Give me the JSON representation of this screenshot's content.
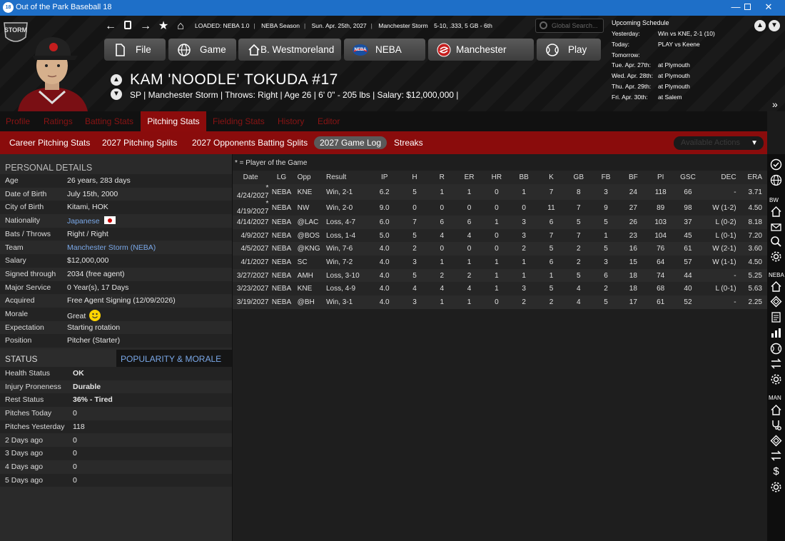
{
  "window": {
    "title": "Out of the Park Baseball 18",
    "app_icon": "18"
  },
  "header": {
    "team_logo_text": "STORM",
    "loaded": [
      "LOADED: NEBA 1.0",
      "NEBA Season",
      "Sun. Apr. 25th, 2027",
      "Manchester Storm",
      "5-10, .333, 5 GB - 6th"
    ],
    "search_placeholder": "Global Search...",
    "menu": [
      {
        "label": "File",
        "icon": "file-icon"
      },
      {
        "label": "Game",
        "icon": "globe-icon"
      },
      {
        "label": "B. Westmoreland",
        "icon": "home-icon"
      },
      {
        "label": "NEBA",
        "icon": "neba-logo-icon"
      },
      {
        "label": "Manchester",
        "icon": "storm-logo-icon"
      },
      {
        "label": "Play",
        "icon": "baseball-icon"
      }
    ],
    "player_name": "KAM 'NOODLE' TOKUDA  #17",
    "player_info": "SP | Manchester Storm  |  Throws: Right  |  Age 26  |  6' 0\" - 205 lbs  |  Salary: $12,000,000  |"
  },
  "schedule": {
    "title": "Upcoming Schedule",
    "rows": [
      {
        "k": "Yesterday:",
        "v": "Win vs KNE, 2-1 (10)"
      },
      {
        "k": "Today:",
        "v": "PLAY vs Keene"
      },
      {
        "k": "Tomorrow:",
        "v": ""
      },
      {
        "k": "Tue. Apr. 27th:",
        "v": "at Plymouth"
      },
      {
        "k": "Wed. Apr. 28th:",
        "v": "at Plymouth"
      },
      {
        "k": "Thu. Apr. 29th:",
        "v": "at Plymouth"
      },
      {
        "k": "Fri. Apr. 30th:",
        "v": "at Salem"
      }
    ]
  },
  "tabs": [
    "Profile",
    "Ratings",
    "Batting Stats",
    "Pitching Stats",
    "Fielding Stats",
    "History",
    "Editor"
  ],
  "active_tab": "Pitching Stats",
  "subtabs": [
    "Career Pitching Stats",
    "2027 Pitching Splits",
    "2027 Opponents Batting Splits",
    "2027 Game Log",
    "Streaks"
  ],
  "active_subtab": "2027 Game Log",
  "actions_label": "Available Actions",
  "personal": {
    "title": "PERSONAL DETAILS",
    "rows": [
      {
        "k": "Age",
        "v": "26 years, 283 days"
      },
      {
        "k": "Date of Birth",
        "v": "July 15th, 2000"
      },
      {
        "k": "City of Birth",
        "v": "Kitami, HOK"
      },
      {
        "k": "Nationality",
        "v": "Japanese"
      },
      {
        "k": "Bats / Throws",
        "v": "Right / Right"
      },
      {
        "k": "Team",
        "v": "Manchester Storm (NEBA)"
      },
      {
        "k": "Salary",
        "v": "$12,000,000"
      },
      {
        "k": "Signed through",
        "v": "2034 (free agent)"
      },
      {
        "k": "Major Service",
        "v": "0 Year(s), 17 Days"
      },
      {
        "k": "Acquired",
        "v": "Free Agent Signing (12/09/2026)"
      },
      {
        "k": "Morale",
        "v": "Great"
      },
      {
        "k": "Expectation",
        "v": "Starting rotation"
      },
      {
        "k": "Position",
        "v": "Pitcher (Starter)"
      }
    ]
  },
  "status": {
    "tab_status": "STATUS",
    "tab_popularity": "POPULARITY & MORALE",
    "rows": [
      {
        "k": "Health Status",
        "v": "OK"
      },
      {
        "k": "Injury Proneness",
        "v": "Durable"
      },
      {
        "k": "Rest Status",
        "v": "36% - Tired"
      },
      {
        "k": "Pitches Today",
        "v": "0"
      },
      {
        "k": "Pitches Yesterday",
        "v": "118"
      },
      {
        "k": "2 Days ago",
        "v": "0"
      },
      {
        "k": "3 Days ago",
        "v": "0"
      },
      {
        "k": "4 Days ago",
        "v": "0"
      },
      {
        "k": "5 Days ago",
        "v": "0"
      }
    ]
  },
  "gamelog": {
    "note": "* = Player of the Game",
    "columns": [
      "Date",
      "LG",
      "Opp",
      "Result",
      "IP",
      "H",
      "R",
      "ER",
      "HR",
      "BB",
      "K",
      "GB",
      "FB",
      "BF",
      "PI",
      "GSC",
      "DEC",
      "ERA"
    ],
    "rows": [
      [
        "* 4/24/2027",
        "NEBA",
        "KNE",
        "Win, 2-1",
        "6.2",
        "5",
        "1",
        "1",
        "0",
        "1",
        "7",
        "8",
        "3",
        "24",
        "118",
        "66",
        "-",
        "3.71"
      ],
      [
        "* 4/19/2027",
        "NEBA",
        "NW",
        "Win, 2-0",
        "9.0",
        "0",
        "0",
        "0",
        "0",
        "0",
        "11",
        "7",
        "9",
        "27",
        "89",
        "98",
        "W (1-2)",
        "4.50"
      ],
      [
        "4/14/2027",
        "NEBA",
        "@LAC",
        "Loss, 4-7",
        "6.0",
        "7",
        "6",
        "6",
        "1",
        "3",
        "6",
        "5",
        "5",
        "26",
        "103",
        "37",
        "L (0-2)",
        "8.18"
      ],
      [
        "4/9/2027",
        "NEBA",
        "@BOS",
        "Loss, 1-4",
        "5.0",
        "5",
        "4",
        "4",
        "0",
        "3",
        "7",
        "7",
        "1",
        "23",
        "104",
        "45",
        "L (0-1)",
        "7.20"
      ],
      [
        "4/5/2027",
        "NEBA",
        "@KNG",
        "Win, 7-6",
        "4.0",
        "2",
        "0",
        "0",
        "0",
        "2",
        "5",
        "2",
        "5",
        "16",
        "76",
        "61",
        "W (2-1)",
        "3.60"
      ],
      [
        "4/1/2027",
        "NEBA",
        "SC",
        "Win, 7-2",
        "4.0",
        "3",
        "1",
        "1",
        "1",
        "1",
        "6",
        "2",
        "3",
        "15",
        "64",
        "57",
        "W (1-1)",
        "4.50"
      ],
      [
        "3/27/2027",
        "NEBA",
        "AMH",
        "Loss, 3-10",
        "4.0",
        "5",
        "2",
        "2",
        "1",
        "1",
        "1",
        "5",
        "6",
        "18",
        "74",
        "44",
        "-",
        "5.25"
      ],
      [
        "3/23/2027",
        "NEBA",
        "KNE",
        "Loss, 4-9",
        "4.0",
        "4",
        "4",
        "4",
        "1",
        "3",
        "5",
        "4",
        "2",
        "18",
        "68",
        "40",
        "L (0-1)",
        "5.63"
      ],
      [
        "3/19/2027",
        "NEBA",
        "@BH",
        "Win, 3-1",
        "4.0",
        "3",
        "1",
        "1",
        "0",
        "2",
        "2",
        "4",
        "5",
        "17",
        "61",
        "52",
        "-",
        "2.25"
      ]
    ]
  },
  "sidebar_labels": {
    "bw": "BW",
    "neba": "NEBA",
    "man": "MAN"
  },
  "colors": {
    "accent_red": "#8a0c0c",
    "link": "#7aa8e8",
    "win": "#4ec24e",
    "loss": "#e04a4a",
    "ok": "#46d246",
    "tired": "#ff8a1e"
  }
}
